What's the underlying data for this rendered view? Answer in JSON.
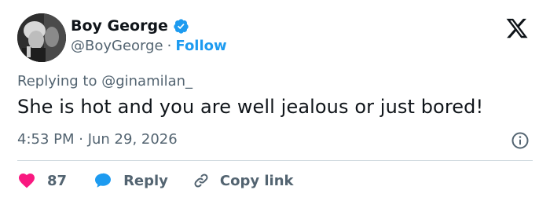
{
  "author": {
    "display_name": "Boy George",
    "handle": "@BoyGeorge",
    "separator": "·",
    "follow_label": "Follow",
    "verified": true
  },
  "reply": {
    "prefix": "Replying to",
    "mention": "@ginamilan_"
  },
  "tweet": {
    "text": "She is hot and you are well jealous or just bored!",
    "timestamp": "4:53 PM · Jun 29, 2026"
  },
  "actions": {
    "like_count": "87",
    "reply_label": "Reply",
    "copy_link_label": "Copy link"
  },
  "icons": {
    "logo": "x-logo-icon",
    "verified": "verified-badge-icon",
    "info": "info-icon",
    "like": "heart-icon",
    "reply": "speech-bubble-icon",
    "copy": "link-icon"
  },
  "colors": {
    "accent": "#1d9bf0",
    "like": "#f91880",
    "text": "#0f1419",
    "muted": "#536471",
    "divider": "#cfd9de"
  }
}
